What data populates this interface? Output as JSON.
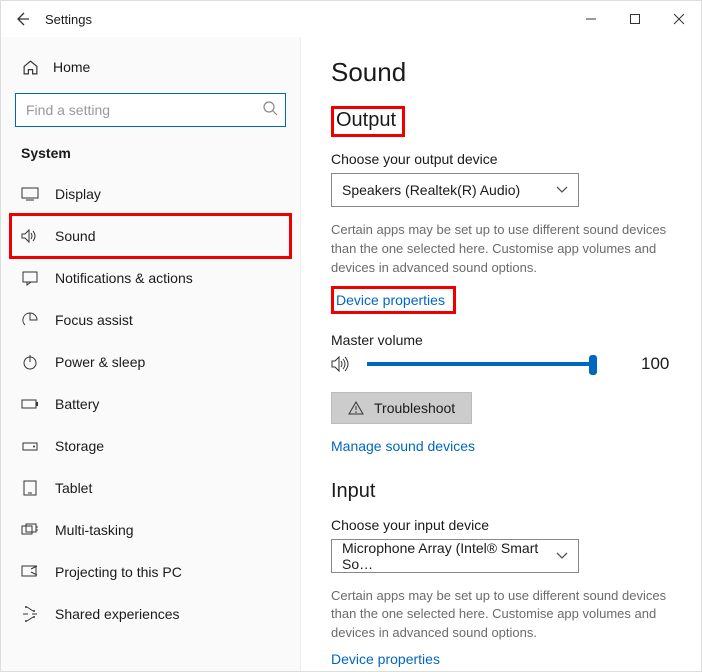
{
  "window": {
    "title": "Settings"
  },
  "sidebar": {
    "home": "Home",
    "search_placeholder": "Find a setting",
    "category": "System",
    "items": [
      {
        "label": "Display"
      },
      {
        "label": "Sound"
      },
      {
        "label": "Notifications & actions"
      },
      {
        "label": "Focus assist"
      },
      {
        "label": "Power & sleep"
      },
      {
        "label": "Battery"
      },
      {
        "label": "Storage"
      },
      {
        "label": "Tablet"
      },
      {
        "label": "Multi-tasking"
      },
      {
        "label": "Projecting to this PC"
      },
      {
        "label": "Shared experiences"
      }
    ]
  },
  "main": {
    "title": "Sound",
    "output": {
      "heading": "Output",
      "choose_label": "Choose your output device",
      "device": "Speakers (Realtek(R) Audio)",
      "note": "Certain apps may be set up to use different sound devices than the one selected here. Customise app volumes and devices in advanced sound options.",
      "device_properties": "Device properties",
      "master_label": "Master volume",
      "master_value": "100",
      "troubleshoot": "Troubleshoot",
      "manage": "Manage sound devices"
    },
    "input": {
      "heading": "Input",
      "choose_label": "Choose your input device",
      "device": "Microphone Array (Intel® Smart So…",
      "note": "Certain apps may be set up to use different sound devices than the one selected here. Customise app volumes and devices in advanced sound options.",
      "device_properties": "Device properties"
    }
  }
}
